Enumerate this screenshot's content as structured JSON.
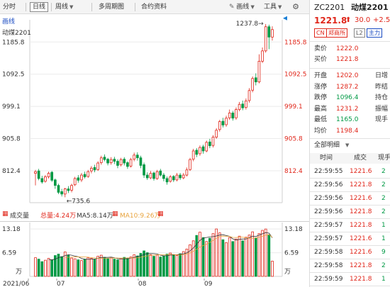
{
  "toolbar": {
    "items": [
      {
        "label": "分时",
        "boxed": false
      },
      {
        "label": "日线",
        "boxed": true
      },
      {
        "label": "周线",
        "boxed": false,
        "dropdown": true
      },
      {
        "label": "多周期图",
        "boxed": false
      },
      {
        "label": "合约资料",
        "boxed": false
      }
    ],
    "draw_label": "画线",
    "tools_label": "工具"
  },
  "main_chart": {
    "indicator_label": "画线",
    "symbol_label": "动煤2201",
    "price_ticks": [
      "1185.8",
      "1092.5",
      "999.1",
      "905.8",
      "812.4"
    ],
    "annotation_high": "1237.8",
    "annotation_low": "735.6"
  },
  "volume_chart": {
    "title": "成交量",
    "total_label": "总量:4.24万",
    "ma5_label": "MA5:8.14万",
    "ma10_label": "MA10:9.26万",
    "ticks": [
      "13.18",
      "6.59"
    ],
    "unit": "万"
  },
  "date_axis": [
    "2021/06",
    "07",
    "08",
    "09"
  ],
  "chart_data": {
    "type": "candlestick",
    "y_ticks": [
      1185.8,
      1092.5,
      999.1,
      905.8,
      812.4
    ],
    "high_marker": 1237.8,
    "low_marker": 735.6,
    "candles": [
      [
        805,
        810,
        770,
        815
      ],
      [
        812,
        790,
        785,
        818
      ],
      [
        790,
        780,
        775,
        798
      ],
      [
        782,
        795,
        778,
        800
      ],
      [
        795,
        805,
        790,
        810
      ],
      [
        808,
        785,
        780,
        812
      ],
      [
        786,
        770,
        760,
        790
      ],
      [
        770,
        750,
        745,
        775
      ],
      [
        752,
        745,
        738,
        760
      ],
      [
        745,
        760,
        735.6,
        763
      ],
      [
        760,
        755,
        748,
        768
      ],
      [
        756,
        770,
        750,
        775
      ],
      [
        772,
        790,
        768,
        795
      ],
      [
        792,
        785,
        778,
        800
      ],
      [
        786,
        800,
        780,
        806
      ],
      [
        802,
        795,
        790,
        810
      ],
      [
        796,
        810,
        792,
        815
      ],
      [
        812,
        820,
        805,
        826
      ],
      [
        822,
        815,
        808,
        830
      ],
      [
        816,
        835,
        812,
        840
      ],
      [
        836,
        850,
        830,
        856
      ],
      [
        852,
        845,
        840,
        860
      ],
      [
        846,
        835,
        828,
        850
      ],
      [
        836,
        845,
        830,
        852
      ],
      [
        846,
        840,
        832,
        853
      ],
      [
        840,
        828,
        820,
        846
      ],
      [
        830,
        845,
        825,
        850
      ],
      [
        846,
        835,
        828,
        852
      ],
      [
        836,
        825,
        818,
        840
      ],
      [
        826,
        845,
        822,
        850
      ],
      [
        846,
        858,
        840,
        865
      ],
      [
        858,
        850,
        842,
        866
      ],
      [
        850,
        828,
        820,
        856
      ],
      [
        830,
        800,
        792,
        836
      ],
      [
        800,
        792,
        786,
        808
      ],
      [
        792,
        805,
        788,
        812
      ],
      [
        806,
        790,
        784,
        810
      ],
      [
        790,
        810,
        786,
        815
      ],
      [
        812,
        800,
        796,
        818
      ],
      [
        800,
        790,
        782,
        806
      ],
      [
        790,
        780,
        772,
        796
      ],
      [
        782,
        795,
        778,
        800
      ],
      [
        796,
        786,
        780,
        800
      ],
      [
        786,
        800,
        782,
        806
      ],
      [
        800,
        792,
        786,
        806
      ],
      [
        792,
        800,
        788,
        806
      ],
      [
        800,
        815,
        796,
        822
      ],
      [
        816,
        845,
        812,
        850
      ],
      [
        846,
        870,
        840,
        876
      ],
      [
        872,
        860,
        852,
        878
      ],
      [
        862,
        880,
        856,
        886
      ],
      [
        882,
        870,
        862,
        888
      ],
      [
        870,
        895,
        866,
        900
      ],
      [
        896,
        885,
        878,
        905
      ],
      [
        886,
        910,
        880,
        916
      ],
      [
        910,
        930,
        905,
        936
      ],
      [
        932,
        955,
        926,
        960
      ],
      [
        956,
        945,
        938,
        966
      ],
      [
        946,
        965,
        940,
        972
      ],
      [
        966,
        980,
        960,
        990
      ],
      [
        980,
        965,
        958,
        986
      ],
      [
        966,
        990,
        960,
        996
      ],
      [
        990,
        1005,
        985,
        1012
      ],
      [
        1006,
        995,
        988,
        1016
      ],
      [
        996,
        1015,
        990,
        1022
      ],
      [
        1016,
        1045,
        1010,
        1052
      ],
      [
        1046,
        1080,
        1040,
        1086
      ],
      [
        1082,
        1070,
        1060,
        1095
      ],
      [
        1070,
        1130,
        1066,
        1150
      ],
      [
        1130,
        1160,
        1125,
        1170
      ],
      [
        1160,
        1230,
        1155,
        1237.8
      ],
      [
        1230,
        1200,
        1165,
        1236
      ],
      [
        1200,
        1221.8,
        1190,
        1231.2
      ]
    ],
    "volume": [
      5.2,
      4.8,
      4.1,
      4.5,
      5.0,
      4.6,
      5.8,
      6.2,
      5.5,
      6.8,
      5.9,
      5.1,
      4.9,
      4.6,
      4.4,
      4.8,
      5.2,
      5.0,
      4.7,
      5.6,
      5.9,
      5.3,
      4.9,
      5.1,
      4.8,
      4.6,
      4.9,
      5.3,
      5.0,
      5.4,
      6.0,
      5.7,
      6.4,
      7.1,
      6.6,
      6.0,
      5.6,
      5.9,
      5.4,
      5.7,
      6.2,
      6.5,
      6.0,
      5.8,
      6.3,
      6.9,
      7.6,
      8.8,
      9.9,
      11.4,
      12.3,
      10.8,
      9.7,
      10.6,
      11.9,
      13.2,
      12.1,
      10.2,
      9.4,
      10.8,
      9.7,
      10.4,
      11.2,
      9.9,
      10.9,
      11.5,
      12.4,
      10.7,
      11.9,
      12.8,
      13.18,
      11.6,
      4.24
    ],
    "volume_ticks": [
      13.18,
      6.59
    ]
  },
  "quote": {
    "code": "ZC2201",
    "name": "动煤2201",
    "price": "1221.8",
    "change": "30.0",
    "pct": "+2.5",
    "tags": [
      "CN",
      "郑商所",
      "L2",
      "主力"
    ],
    "ask_label": "卖价",
    "ask": "1222.0",
    "bid_label": "买价",
    "bid": "1221.8",
    "stats": [
      {
        "label": "开盘",
        "value": "1202.0",
        "color": "red",
        "extra": "日增"
      },
      {
        "label": "涨停",
        "value": "1287.2",
        "color": "red",
        "extra": "昨结"
      },
      {
        "label": "跌停",
        "value": "1096.4",
        "color": "green",
        "extra": "持仓"
      },
      {
        "label": "最高",
        "value": "1231.2",
        "color": "red",
        "extra": "振幅"
      },
      {
        "label": "最低",
        "value": "1165.0",
        "color": "green",
        "extra": "现手"
      },
      {
        "label": "均价",
        "value": "1198.4",
        "color": "red",
        "extra": ""
      }
    ],
    "ticks_filter": "全部明细",
    "ticks_header": {
      "time": "时间",
      "price": "成交",
      "qty": "现手"
    },
    "ticks": [
      {
        "time": "22:59:55",
        "price": "1221.6",
        "qty": "2"
      },
      {
        "time": "22:59:56",
        "price": "1221.8",
        "qty": "2"
      },
      {
        "time": "22:59:56",
        "price": "1221.6",
        "qty": "2"
      },
      {
        "time": "22:59:56",
        "price": "1221.8",
        "qty": "2"
      },
      {
        "time": "22:59:57",
        "price": "1221.8",
        "qty": "1"
      },
      {
        "time": "22:59:57",
        "price": "1221.6",
        "qty": "1"
      },
      {
        "time": "22:59:58",
        "price": "1221.6",
        "qty": "9"
      },
      {
        "time": "22:59:58",
        "price": "1221.8",
        "qty": "2"
      },
      {
        "time": "22:59:59",
        "price": "1221.8",
        "qty": "1"
      }
    ]
  },
  "colors": {
    "up": "#e0261a",
    "down": "#009944",
    "ma5": "#333333",
    "ma10": "#e8a33c",
    "grid": "#ebebeb"
  }
}
